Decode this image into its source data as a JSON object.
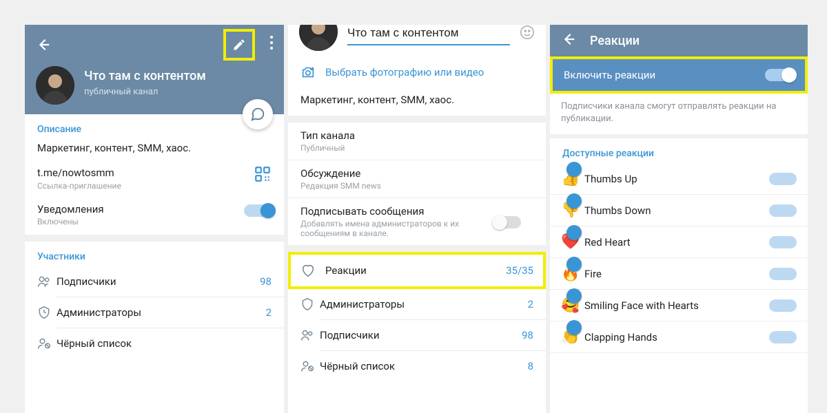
{
  "screen1": {
    "channel_title": "Что там с контентом",
    "channel_subtitle": "публичный канал",
    "section_description_title": "Описание",
    "description": "Маркетинг, контент, SMM, хаос.",
    "link": "t.me/nowtosmm",
    "link_label": "Ссылка-приглашение",
    "notifications_title": "Уведомления",
    "notifications_value": "Включены",
    "members_title": "Участники",
    "rows": {
      "subs_label": "Подписчики",
      "subs_value": "98",
      "admins_label": "Администраторы",
      "admins_value": "2",
      "black_label": "Чёрный список"
    }
  },
  "screen2": {
    "name_value": "Что там с контентом",
    "photo_pick": "Выбрать фотографию или видео",
    "description": "Маркетинг, контент, SMM, хаос.",
    "type_title": "Тип канала",
    "type_value": "Публичный",
    "discussion_title": "Обсуждение",
    "discussion_value": "Редакция SMM news",
    "sign_title": "Подписывать сообщения",
    "sign_sub": "Добавлять имена администраторов к их сообщениям в канале.",
    "reactions_title": "Реакции",
    "reactions_value": "35/35",
    "admins_label": "Администраторы",
    "admins_value": "2",
    "subs_label": "Подписчики",
    "subs_value": "98",
    "black_label": "Чёрный список",
    "black_value": "8"
  },
  "screen3": {
    "header": "Реакции",
    "enable_label": "Включить реакции",
    "hint": "Подписчики канала смогут отправлять реакции на публикации.",
    "avail_title": "Доступные реакции",
    "reactions": [
      {
        "emoji": "👍",
        "label": "Thumbs Up"
      },
      {
        "emoji": "👎",
        "label": "Thumbs Down"
      },
      {
        "emoji": "❤️",
        "label": "Red Heart"
      },
      {
        "emoji": "🔥",
        "label": "Fire"
      },
      {
        "emoji": "🥰",
        "label": "Smiling Face with Hearts"
      },
      {
        "emoji": "👏",
        "label": "Clapping Hands"
      }
    ]
  }
}
